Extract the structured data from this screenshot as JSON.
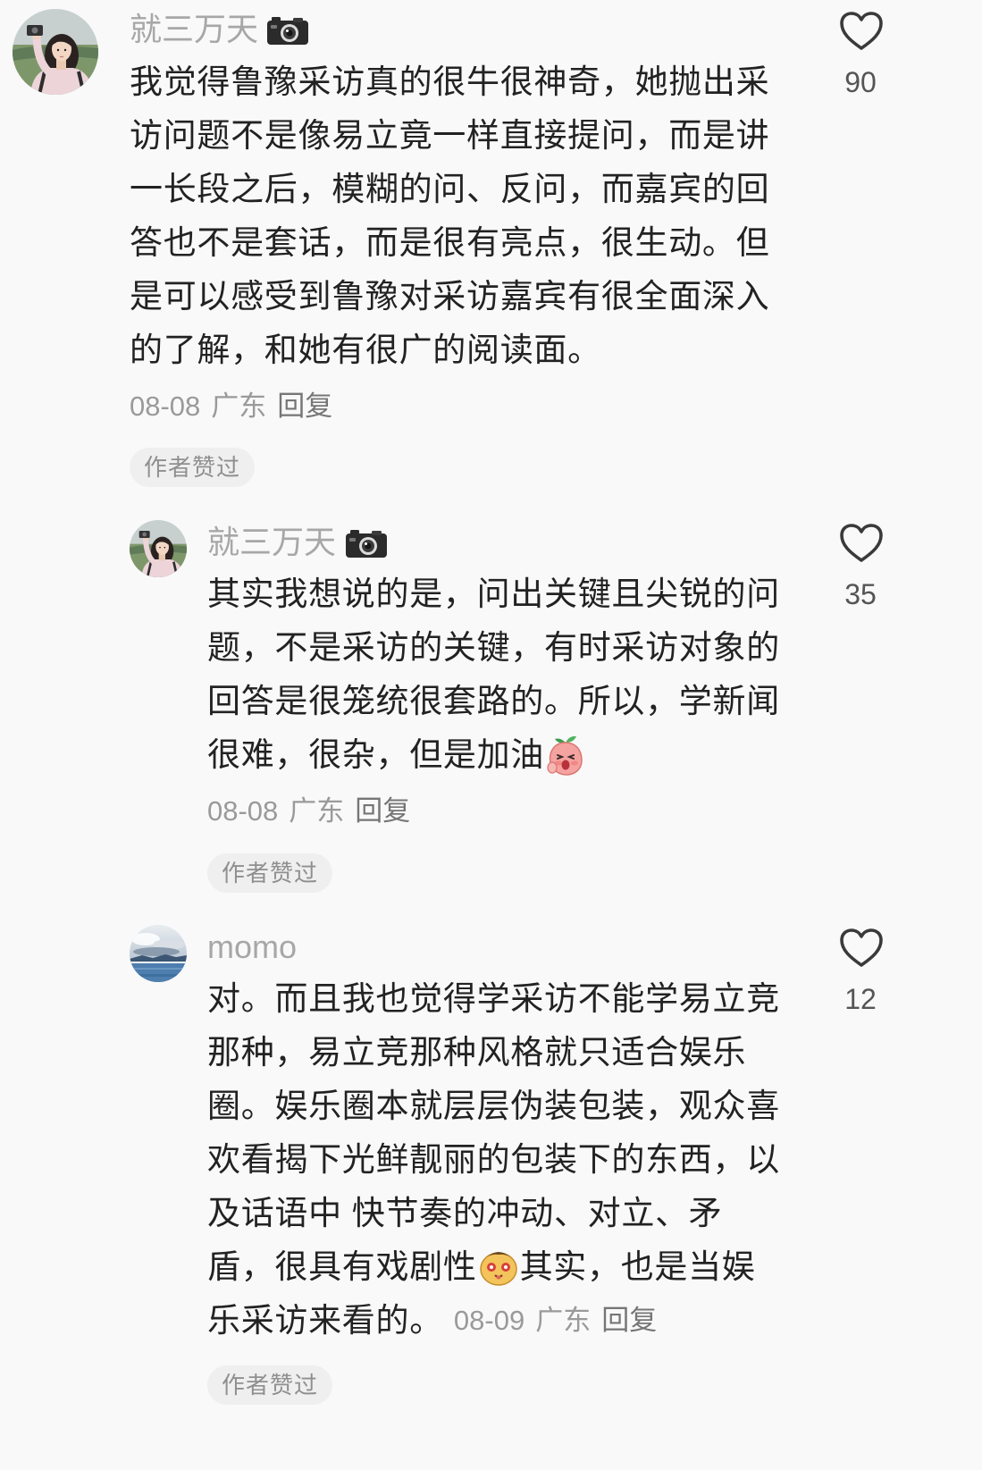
{
  "colors": {
    "background": "#f9f9f9",
    "text": "#222222",
    "muted": "#9a9a9a",
    "badge_bg": "#efefef",
    "like_icon": "#3a3a3a"
  },
  "comments": [
    {
      "username": "就三万天",
      "name_icon": "camera-icon",
      "lines": [
        {
          "text": "我觉得鲁豫采访真的很牛很神奇，她抛出采"
        },
        {
          "text": "访问题不是像易立竟一样直接提问，而是讲"
        },
        {
          "text": "一长段之后，模糊的问、反问，而嘉宾的回"
        },
        {
          "text": "答也不是套话，而是很有亮点，很生动。但"
        },
        {
          "text": "是可以感受到鲁豫对采访嘉宾有很全面深入"
        },
        {
          "text": "的了解，和她有很广的阅读面。"
        }
      ],
      "date": "08-08",
      "location": "广东",
      "reply_label": "回复",
      "author_badge": "作者赞过",
      "like_icon": "heart-outline-icon",
      "likes": 90
    },
    {
      "username": "就三万天",
      "name_icon": "camera-icon",
      "lines": [
        {
          "text": "其实我想说的是，问出关键且尖锐的问"
        },
        {
          "text": "题，不是采访的关键，有时采访对象的"
        },
        {
          "text": "回答是很笼统很套路的。所以，学新闻"
        },
        {
          "text": "很难，很杂，但是加油",
          "emoji": "peach-cheer-emoji"
        }
      ],
      "date": "08-08",
      "location": "广东",
      "reply_label": "回复",
      "author_badge": "作者赞过",
      "like_icon": "heart-outline-icon",
      "likes": 35
    },
    {
      "username": "momo",
      "lines": [
        {
          "text": "对。而且我也觉得学采访不能学易立竞"
        },
        {
          "text": "那种，易立竞那种风格就只适合娱乐"
        },
        {
          "text": "圈。娱乐圈本就层层伪装包装，观众喜"
        },
        {
          "text": "欢看揭下光鲜靓丽的包装下的东西，以"
        },
        {
          "text": "及话语中 快节奏的冲动、对立、矛"
        },
        {
          "text": "盾，很具有戏剧性",
          "emoji": "yellow-face-emoji",
          "text_after": "其实，也是当娱"
        },
        {
          "text": "乐采访来看的。"
        }
      ],
      "date": "08-09",
      "location": "广东",
      "reply_label": "回复",
      "author_badge": "作者赞过",
      "like_icon": "heart-outline-icon",
      "likes": 12
    }
  ]
}
